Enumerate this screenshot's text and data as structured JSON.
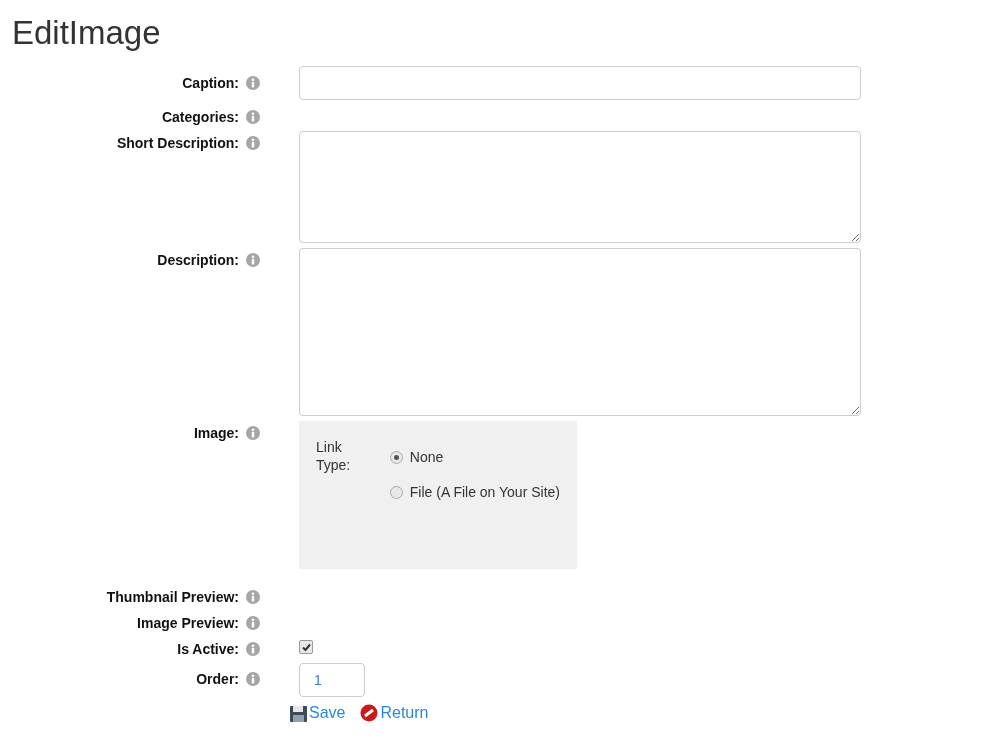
{
  "title": "EditImage",
  "fields": [
    {
      "kind": "text",
      "label": "Caption:"
    },
    {
      "kind": "none",
      "label": "Categories:"
    },
    {
      "kind": "short-textarea",
      "label": "Short Description:"
    },
    {
      "kind": "textarea",
      "label": "Description:"
    },
    {
      "kind": "link-type",
      "label": "Image:",
      "link_type_label": "Link Type:",
      "options": [
        {
          "label": "None",
          "selected": true
        },
        {
          "label": "File (A File on Your Site)",
          "selected": false
        }
      ]
    },
    {
      "kind": "none",
      "label": "Thumbnail Preview:"
    },
    {
      "kind": "none",
      "label": "Image Preview:"
    },
    {
      "kind": "checkbox",
      "label": "Is Active:",
      "checked": true
    },
    {
      "kind": "number",
      "label": "Order:",
      "value": "1"
    }
  ],
  "actions": [
    {
      "kind": "save",
      "label": "Save"
    },
    {
      "kind": "return",
      "label": "Return"
    }
  ]
}
